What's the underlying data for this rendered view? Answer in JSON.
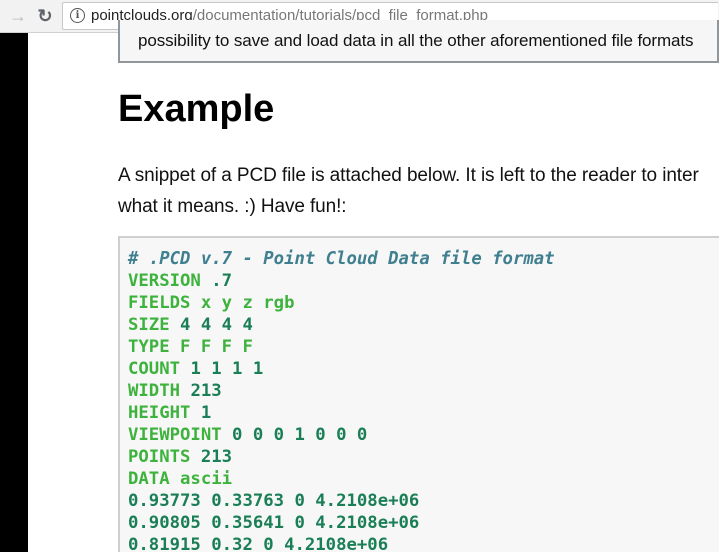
{
  "browser": {
    "back_icon": "arrow-right-icon",
    "reload_icon": "reload-icon",
    "url_host": "pointclouds.org",
    "url_path": "/documentation/tutorials/pcd_file_format.php"
  },
  "note": {
    "text": "possibility to save and load data in all the other aforementioned file formats"
  },
  "heading": "Example",
  "paragraph": {
    "line1": "A snippet of a PCD file is attached below. It is left to the reader to inter",
    "line2": "what it means. :) Have fun!:"
  },
  "code": {
    "lines": [
      [
        [
          "cmt",
          "# .PCD v.7 - Point Cloud Data file format"
        ]
      ],
      [
        [
          "kw",
          "VERSION "
        ],
        [
          "num",
          ".7"
        ]
      ],
      [
        [
          "kw",
          "FIELDS x y z rgb"
        ]
      ],
      [
        [
          "kw",
          "SIZE "
        ],
        [
          "num",
          "4 4 4 4"
        ]
      ],
      [
        [
          "kw",
          "TYPE F F F F"
        ]
      ],
      [
        [
          "kw",
          "COUNT "
        ],
        [
          "num",
          "1 1 1 1"
        ]
      ],
      [
        [
          "kw",
          "WIDTH "
        ],
        [
          "num",
          "213"
        ]
      ],
      [
        [
          "kw",
          "HEIGHT "
        ],
        [
          "num",
          "1"
        ]
      ],
      [
        [
          "kw",
          "VIEWPOINT "
        ],
        [
          "num",
          "0 0 0 1 0 0 0"
        ]
      ],
      [
        [
          "kw",
          "POINTS "
        ],
        [
          "num",
          "213"
        ]
      ],
      [
        [
          "kw",
          "DATA ascii"
        ]
      ],
      [
        [
          "num",
          "0.93773 0.33763 0 4.2108e+06"
        ]
      ],
      [
        [
          "num",
          "0.90805 0.35641 0 4.2108e+06"
        ]
      ],
      [
        [
          "num",
          "0.81915 0.32 0 4.2108e+06"
        ]
      ]
    ]
  },
  "colors": {
    "keyword": "#3db23d",
    "number": "#1a7f57",
    "comment": "#3f7f8f"
  }
}
